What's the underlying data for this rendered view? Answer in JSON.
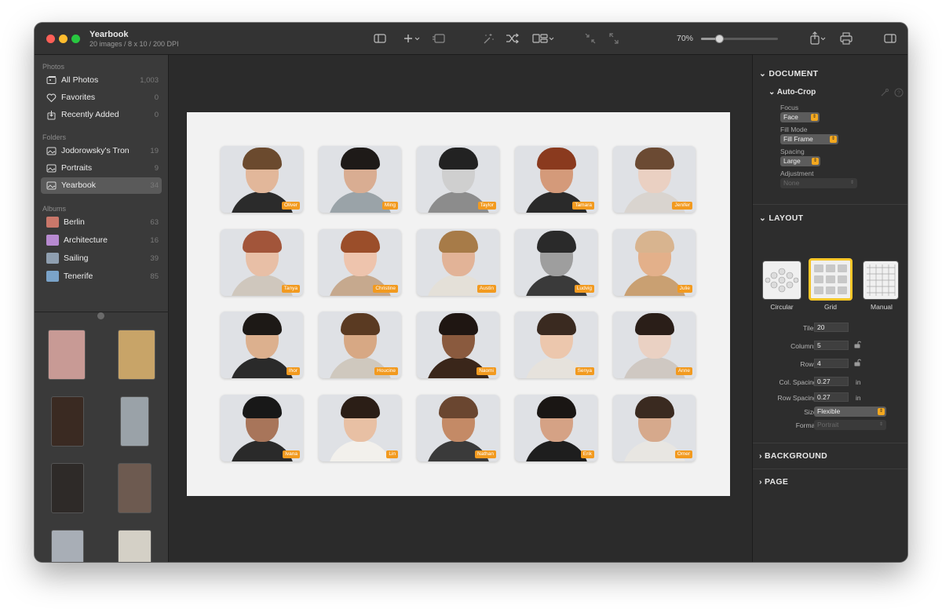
{
  "window": {
    "title": "Yearbook",
    "subtitle": "20 images / 8 x 10 / 200 DPI",
    "zoom": "70%",
    "zoom_level": 0.23
  },
  "sidebar": {
    "photos_header": "Photos",
    "photos": [
      {
        "label": "All Photos",
        "count": "1,003",
        "icon": "photos-icon"
      },
      {
        "label": "Favorites",
        "count": "0",
        "icon": "heart-icon"
      },
      {
        "label": "Recently Added",
        "count": "0",
        "icon": "recent-icon"
      }
    ],
    "folders_header": "Folders",
    "folders": [
      {
        "label": "Jodorowsky's Tron",
        "count": "19",
        "icon": "folder-icon"
      },
      {
        "label": "Portraits",
        "count": "9",
        "icon": "folder-icon"
      },
      {
        "label": "Yearbook",
        "count": "34",
        "icon": "folder-icon",
        "selected": true
      }
    ],
    "albums_header": "Albums",
    "albums": [
      {
        "label": "Berlin",
        "count": "63",
        "color": "#c9776a"
      },
      {
        "label": "Architecture",
        "count": "16",
        "color": "#b78ad0"
      },
      {
        "label": "Sailing",
        "count": "39",
        "color": "#8f9fb0"
      },
      {
        "label": "Tenerife",
        "count": "85",
        "color": "#7aa3c9"
      }
    ],
    "thumb_colors": [
      "#c89a95",
      "#c8a468",
      "#3a2a22",
      "#9aa2a8",
      "#2e2a28",
      "#6d5a50",
      "#a8aeb6",
      "#d4d0c6"
    ]
  },
  "canvas": {
    "people": [
      {
        "name": "Oliver",
        "skin": "#e2b79a",
        "hair": "#6b4a2e",
        "cloth": "#2b2b2b"
      },
      {
        "name": "Ming",
        "skin": "#d9ad92",
        "hair": "#1e1a18",
        "cloth": "#9aa3a8"
      },
      {
        "name": "Taylor",
        "skin": "#cfcfcf",
        "hair": "#222222",
        "cloth": "#8c8c8c"
      },
      {
        "name": "Tamara",
        "skin": "#d49a7a",
        "hair": "#8a3a1e",
        "cloth": "#2a2a2a"
      },
      {
        "name": "Jenifer",
        "skin": "#ead0c2",
        "hair": "#6b4a33",
        "cloth": "#d9d4cf"
      },
      {
        "name": "Tanya",
        "skin": "#e8bfa6",
        "hair": "#a2553a",
        "cloth": "#cfc7bd"
      },
      {
        "name": "Christine",
        "skin": "#eec4ad",
        "hair": "#9b4e2a",
        "cloth": "#c6a98e"
      },
      {
        "name": "Austin",
        "skin": "#e2b397",
        "hair": "#a77b48",
        "cloth": "#e4e0d8"
      },
      {
        "name": "Ludvig",
        "skin": "#9e9e9e",
        "hair": "#2a2a2a",
        "cloth": "#3a3a3a"
      },
      {
        "name": "Julie",
        "skin": "#e3b08a",
        "hair": "#d8b48f",
        "cloth": "#c9a072"
      },
      {
        "name": "Ihor",
        "skin": "#dcb08e",
        "hair": "#1d1916",
        "cloth": "#2a2a2a"
      },
      {
        "name": "Houcine",
        "skin": "#d7a884",
        "hair": "#5a3a22",
        "cloth": "#cfc8be"
      },
      {
        "name": "Naomi",
        "skin": "#8a5a3e",
        "hair": "#1f1612",
        "cloth": "#3a261a"
      },
      {
        "name": "Senya",
        "skin": "#ecc7ad",
        "hair": "#3a2a20",
        "cloth": "#e6e2dc"
      },
      {
        "name": "Anne",
        "skin": "#ead1c3",
        "hair": "#2a1e18",
        "cloth": "#cfc8c2"
      },
      {
        "name": "Ivana",
        "skin": "#a8755a",
        "hair": "#181818",
        "cloth": "#2a2a2a"
      },
      {
        "name": "Lin",
        "skin": "#e8c0a4",
        "hair": "#2b1e16",
        "cloth": "#f2f0ec"
      },
      {
        "name": "Nathan",
        "skin": "#c48a66",
        "hair": "#6a4630",
        "cloth": "#3a3a3a"
      },
      {
        "name": "Erik",
        "skin": "#d5a285",
        "hair": "#1a1614",
        "cloth": "#1e1e1e"
      },
      {
        "name": "Omer",
        "skin": "#d6a98c",
        "hair": "#3a2a20",
        "cloth": "#e8e6e2"
      }
    ]
  },
  "inspector": {
    "document_title": "DOCUMENT",
    "autocrop_title": "Auto-Crop",
    "focus_label": "Focus",
    "focus_value": "Face",
    "fillmode_label": "Fill Mode",
    "fillmode_value": "Fill Frame",
    "spacing_label": "Spacing",
    "spacing_value": "Large",
    "adjustment_label": "Adjustment",
    "adjustment_value": "None",
    "layout_title": "LAYOUT",
    "layout_options": [
      "Circular",
      "Grid",
      "Manual"
    ],
    "tiles_label": "Tiles:",
    "tiles_value": "20",
    "columns_label": "Columns:",
    "columns_value": "5",
    "rows_label": "Rows:",
    "rows_value": "4",
    "colspacing_label": "Col. Spacing:",
    "colspacing_value": "0.27",
    "rowspacing_label": "Row Spacing:",
    "rowspacing_value": "0.27",
    "unit": "in",
    "size_label": "Size:",
    "size_value": "Flexible",
    "format_label": "Format:",
    "format_value": "Portrait",
    "background_title": "BACKGROUND",
    "page_title": "PAGE"
  }
}
